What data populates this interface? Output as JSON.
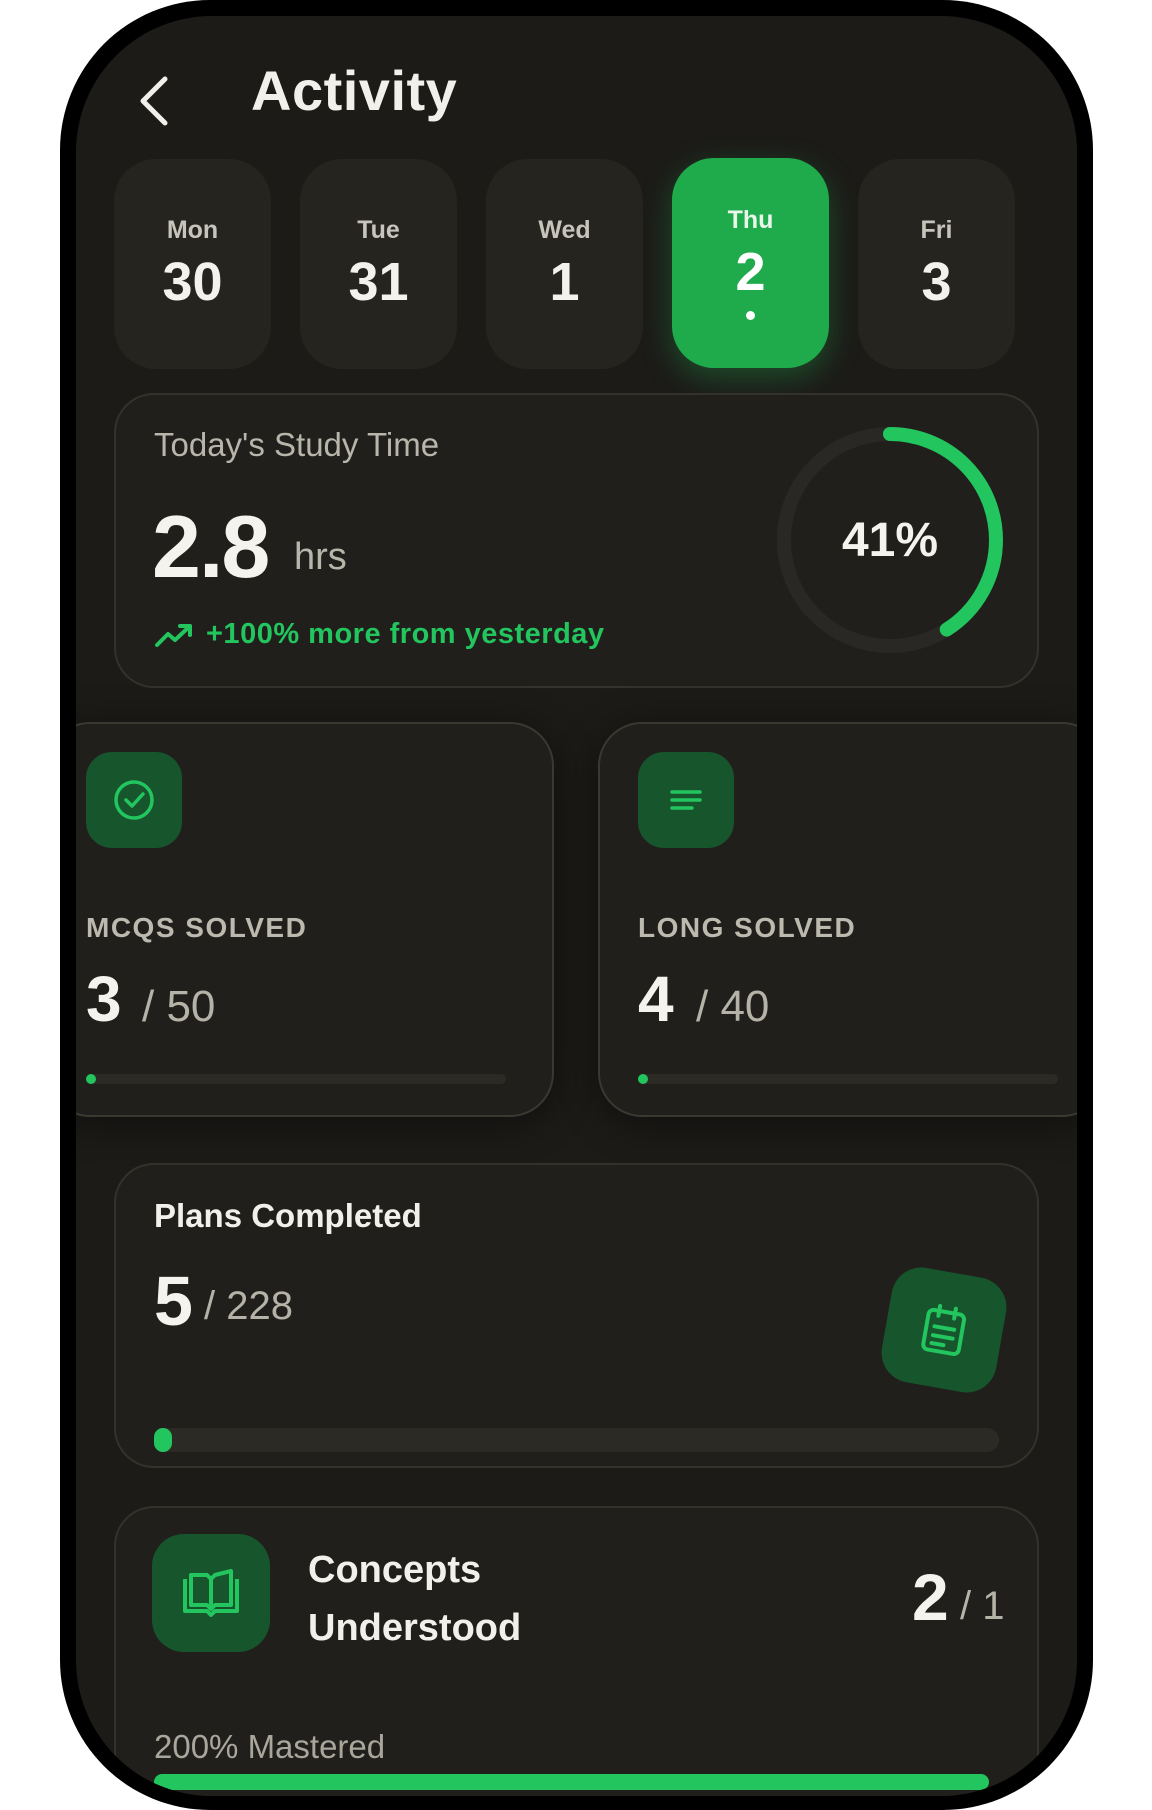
{
  "header": {
    "title": "Activity",
    "back_icon": "chevron-left-icon"
  },
  "days": [
    {
      "name": "Mon",
      "num": "30",
      "active": false
    },
    {
      "name": "Tue",
      "num": "31",
      "active": false
    },
    {
      "name": "Wed",
      "num": "1",
      "active": false
    },
    {
      "name": "Thu",
      "num": "2",
      "active": true
    },
    {
      "name": "Fri",
      "num": "3",
      "active": false
    }
  ],
  "study": {
    "label": "Today's Study Time",
    "value": "2.8",
    "unit": "hrs",
    "trend": "+100% more from yesterday",
    "trend_icon": "trending-up-icon",
    "percent_label": "41%",
    "percent": 41
  },
  "mcqs": {
    "icon": "check-circle-icon",
    "label": "MCQS SOLVED",
    "value": "3",
    "total": "/ 50",
    "progress": 0.06
  },
  "long": {
    "icon": "lines-icon",
    "label": "LONG SOLVED",
    "value": "4",
    "total": "/ 40",
    "progress": 0.1
  },
  "plans": {
    "label": "Plans Completed",
    "value": "5",
    "total": "/ 228",
    "icon": "calendar-notes-icon",
    "progress": 0.022
  },
  "concepts": {
    "icon": "open-book-icon",
    "title_line1": "Concepts",
    "title_line2": "Understood",
    "value": "2",
    "total": "/ 1",
    "mastered": "200% Mastered",
    "progress": 1.0
  },
  "colors": {
    "accent": "#22c55e",
    "active_day": "#1faa4c",
    "background": "#1c1b18",
    "card": "#201f1b",
    "icon_bg": "#17552d"
  }
}
